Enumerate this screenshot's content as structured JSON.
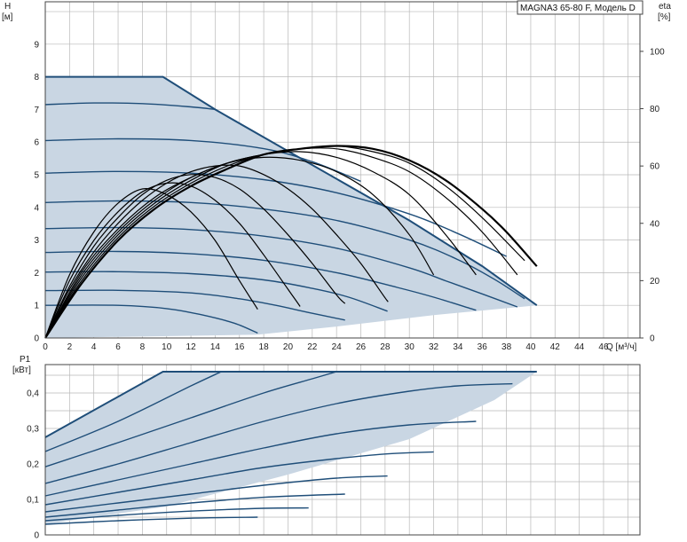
{
  "chart_data": [
    {
      "type": "line",
      "title": "MAGNA3 65-80 F, Модель D",
      "ylabel_name": "H",
      "ylabel_unit": "[м]",
      "y2label_name": "eta",
      "y2label_unit": "[%]",
      "xlabel": "Q [м³/ч]",
      "xlim": [
        0,
        49
      ],
      "ylim": [
        0,
        10.3
      ],
      "y2lim": [
        0,
        117.3
      ],
      "x_ticks": [
        0,
        2,
        4,
        6,
        8,
        10,
        12,
        14,
        16,
        18,
        20,
        22,
        24,
        26,
        28,
        30,
        32,
        34,
        36,
        38,
        40,
        42,
        44,
        46
      ],
      "y_ticks": [
        0,
        1,
        2,
        3,
        4,
        5,
        6,
        7,
        8,
        9
      ],
      "y2_ticks": [
        0,
        20,
        40,
        60,
        80,
        100
      ],
      "grid": true,
      "envelope": {
        "x": [
          0,
          9.7,
          14,
          22,
          30,
          36,
          40.5,
          40.5,
          32,
          24,
          17.5,
          0
        ],
        "y": [
          8,
          8,
          7,
          5.3,
          3.6,
          2.2,
          1.0,
          1.0,
          0.7,
          0.35,
          0.1,
          0
        ]
      },
      "series": [
        {
          "x": [
            0,
            9.7,
            14,
            22,
            30,
            36,
            40.5
          ],
          "y": [
            8,
            8,
            7,
            5.3,
            3.6,
            2.2,
            1.0
          ]
        },
        {
          "x": [
            0,
            4,
            8,
            12,
            14
          ],
          "y": [
            7.15,
            7.2,
            7.18,
            7.08,
            7.0
          ]
        },
        {
          "x": [
            0,
            6,
            12,
            18,
            22,
            26
          ],
          "y": [
            6.05,
            6.1,
            6.05,
            5.8,
            5.4,
            4.8
          ]
        },
        {
          "x": [
            0,
            6,
            12,
            18,
            24,
            30,
            34,
            38
          ],
          "y": [
            5.05,
            5.1,
            5.05,
            4.85,
            4.45,
            3.8,
            3.2,
            2.5
          ]
        },
        {
          "x": [
            0,
            6,
            12,
            18,
            24,
            30,
            34,
            37,
            39.5
          ],
          "y": [
            4.15,
            4.2,
            4.15,
            3.95,
            3.6,
            3.0,
            2.4,
            1.8,
            1.2
          ]
        },
        {
          "x": [
            0,
            6,
            12,
            18,
            24,
            30,
            33,
            36,
            38.9
          ],
          "y": [
            3.35,
            3.38,
            3.32,
            3.12,
            2.75,
            2.15,
            1.75,
            1.35,
            0.95
          ]
        },
        {
          "x": [
            0,
            6,
            12,
            18,
            24,
            29,
            32,
            35.5
          ],
          "y": [
            2.62,
            2.65,
            2.58,
            2.38,
            2.0,
            1.55,
            1.25,
            0.85
          ]
        },
        {
          "x": [
            0,
            6,
            12,
            18,
            22,
            25,
            28.2
          ],
          "y": [
            2.02,
            2.03,
            1.97,
            1.78,
            1.52,
            1.25,
            0.82
          ]
        },
        {
          "x": [
            0,
            6,
            12,
            16,
            19,
            21.7,
            24.7
          ],
          "y": [
            1.45,
            1.46,
            1.38,
            1.2,
            1.0,
            0.78,
            0.55
          ]
        },
        {
          "x": [
            0,
            6,
            10,
            13,
            15.6,
            17.5
          ],
          "y": [
            1.0,
            1.0,
            0.9,
            0.7,
            0.45,
            0.15
          ]
        }
      ],
      "eta_series": [
        {
          "x": [
            0,
            2,
            4,
            6,
            8,
            10,
            12,
            14,
            16,
            17.5
          ],
          "y": [
            0,
            22,
            37,
            47,
            52,
            50,
            44,
            34,
            20,
            10
          ]
        },
        {
          "x": [
            0,
            2,
            4,
            6,
            8,
            10,
            12,
            14,
            16,
            18,
            20,
            21
          ],
          "y": [
            0,
            20,
            34,
            44,
            51,
            54,
            53,
            48,
            40,
            29,
            17,
            11
          ]
        },
        {
          "x": [
            0,
            2,
            4,
            6,
            8,
            10,
            12,
            14,
            16,
            18,
            20,
            22,
            24,
            24.7
          ],
          "y": [
            0,
            18,
            32,
            42,
            50,
            55,
            57,
            56,
            52,
            45,
            36,
            26,
            15,
            12
          ]
        },
        {
          "x": [
            0,
            2,
            4,
            6,
            8,
            10,
            12,
            14,
            16,
            18,
            20,
            22,
            24,
            26,
            28,
            28.2
          ],
          "y": [
            0,
            17,
            30,
            40,
            48,
            54,
            58,
            60,
            60,
            57,
            52,
            45,
            36,
            26,
            14,
            13
          ]
        },
        {
          "x": [
            0,
            3,
            6,
            9,
            12,
            15,
            18,
            21,
            24,
            27,
            30,
            32
          ],
          "y": [
            0,
            23,
            38,
            49,
            56,
            61,
            63,
            62,
            58,
            50,
            36,
            22
          ]
        },
        {
          "x": [
            0,
            3,
            6,
            9,
            12,
            15,
            18,
            21,
            24,
            27,
            30,
            33,
            35.5
          ],
          "y": [
            0,
            22,
            37,
            48,
            56,
            61,
            64,
            65,
            63,
            58,
            50,
            36,
            22
          ]
        },
        {
          "x": [
            0,
            3,
            6,
            9,
            12,
            15,
            18,
            21,
            24,
            27,
            30,
            33,
            36,
            38.9
          ],
          "y": [
            0,
            21,
            36,
            47,
            55,
            61,
            64,
            66,
            66,
            63,
            58,
            49,
            37,
            22
          ]
        },
        {
          "x": [
            0,
            3,
            6,
            9,
            12,
            15,
            18,
            21,
            24,
            27,
            30,
            33,
            36,
            39.5
          ],
          "y": [
            0,
            20,
            35,
            46,
            54,
            60,
            64,
            66,
            67,
            65,
            61,
            53,
            42,
            27
          ]
        },
        {
          "x": [
            0,
            3,
            6,
            9,
            12,
            15,
            18,
            21,
            24,
            27,
            30,
            33,
            36,
            38,
            40.5
          ],
          "y": [
            0,
            19,
            34,
            45,
            53,
            59,
            64,
            66,
            67,
            66,
            62,
            55,
            45,
            37,
            25
          ]
        }
      ]
    },
    {
      "type": "line",
      "ylabel_name": "P1",
      "ylabel_unit": "[кВт]",
      "xlim": [
        0,
        49
      ],
      "ylim": [
        0,
        0.48
      ],
      "y_ticks": [
        0,
        0.1,
        0.2,
        0.3,
        0.4
      ],
      "y_tick_labels": [
        "0",
        "0,1",
        "0,2",
        "0,3",
        "0,4"
      ],
      "grid": true,
      "envelope": {
        "x": [
          0,
          9.7,
          40.5,
          37,
          30,
          20,
          10,
          0
        ],
        "y": [
          0.275,
          0.46,
          0.46,
          0.38,
          0.27,
          0.17,
          0.08,
          0.03
        ]
      },
      "series": [
        {
          "x": [
            0,
            9.7,
            40.5
          ],
          "y": [
            0.275,
            0.46,
            0.46
          ]
        },
        {
          "x": [
            0,
            6,
            12,
            14.5
          ],
          "y": [
            0.235,
            0.32,
            0.42,
            0.46
          ]
        },
        {
          "x": [
            0,
            6,
            12,
            18,
            22,
            24
          ],
          "y": [
            0.192,
            0.26,
            0.33,
            0.4,
            0.44,
            0.46
          ]
        },
        {
          "x": [
            0,
            6,
            12,
            18,
            24,
            30,
            34,
            38.5
          ],
          "y": [
            0.145,
            0.2,
            0.26,
            0.32,
            0.37,
            0.405,
            0.42,
            0.426
          ]
        },
        {
          "x": [
            0,
            6,
            12,
            18,
            24,
            30,
            35.5
          ],
          "y": [
            0.11,
            0.155,
            0.2,
            0.245,
            0.285,
            0.31,
            0.32
          ]
        },
        {
          "x": [
            0,
            6,
            12,
            18,
            24,
            28,
            32
          ],
          "y": [
            0.085,
            0.12,
            0.155,
            0.19,
            0.215,
            0.228,
            0.234
          ]
        },
        {
          "x": [
            0,
            6,
            12,
            18,
            24,
            28.2
          ],
          "y": [
            0.065,
            0.09,
            0.115,
            0.14,
            0.16,
            0.166
          ]
        },
        {
          "x": [
            0,
            6,
            12,
            18,
            24.7
          ],
          "y": [
            0.05,
            0.07,
            0.09,
            0.106,
            0.115
          ]
        },
        {
          "x": [
            0,
            6,
            12,
            18,
            21.7
          ],
          "y": [
            0.04,
            0.055,
            0.067,
            0.075,
            0.076
          ]
        },
        {
          "x": [
            0,
            6,
            12,
            17.5
          ],
          "y": [
            0.03,
            0.04,
            0.047,
            0.05
          ]
        }
      ]
    }
  ]
}
